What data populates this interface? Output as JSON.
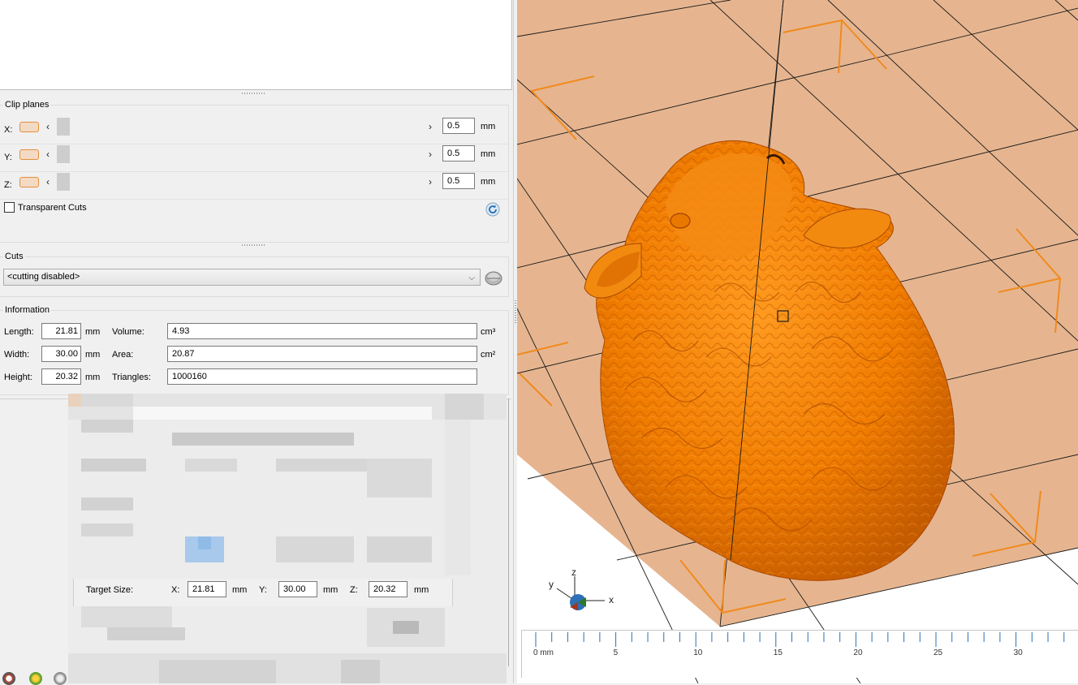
{
  "clip_planes": {
    "title": "Clip planes",
    "rows": [
      {
        "axis": "X:",
        "value": "0.5",
        "unit": "mm"
      },
      {
        "axis": "Y:",
        "value": "0.5",
        "unit": "mm"
      },
      {
        "axis": "Z:",
        "value": "0.5",
        "unit": "mm"
      }
    ],
    "transparent_cuts_label": "Transparent Cuts"
  },
  "cuts": {
    "title": "Cuts",
    "selected": "<cutting disabled>"
  },
  "information": {
    "title": "Information",
    "length_label": "Length:",
    "length_value": "21.81",
    "length_unit": "mm",
    "width_label": "Width:",
    "width_value": "30.00",
    "width_unit": "mm",
    "height_label": "Height:",
    "height_value": "20.32",
    "height_unit": "mm",
    "volume_label": "Volume:",
    "volume_value": "4.93",
    "volume_unit": "cm³",
    "area_label": "Area:",
    "area_value": "20.87",
    "area_unit": "cm²",
    "triangles_label": "Triangles:",
    "triangles_value": "1000160"
  },
  "target_size": {
    "label": "Target Size:",
    "x_label": "X:",
    "x_value": "21.81",
    "x_unit": "mm",
    "y_label": "Y:",
    "y_value": "30.00",
    "y_unit": "mm",
    "z_label": "Z:",
    "z_value": "20.32",
    "z_unit": "mm"
  },
  "axes_gizmo": {
    "x": "x",
    "y": "y",
    "z": "z"
  },
  "ruler": {
    "labels": [
      "0 mm",
      "5",
      "10",
      "15",
      "20",
      "25",
      "30"
    ]
  },
  "colors": {
    "model": "#f07c00",
    "platform": "#e6b58f",
    "build_volume_marker": "#f08a1e",
    "accent_swatch": "#e4903c"
  }
}
